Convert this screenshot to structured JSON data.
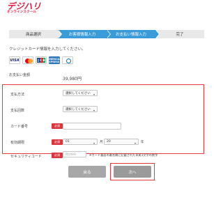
{
  "logo": {
    "main": "デジハリ",
    "sub": "オンラインスクール"
  },
  "steps": [
    {
      "label": "商品選択",
      "state": "done"
    },
    {
      "label": "お客様情報入力",
      "state": "active"
    },
    {
      "label": "お支払い情報入力",
      "state": "active"
    },
    {
      "label": "完了",
      "state": "todo"
    }
  ],
  "intro": "クレジットカード情報を入力してください。",
  "cards": {
    "visa": "VISA",
    "amex": "AMERICAN EXPRESS",
    "jcb": [
      "J",
      "C",
      "B"
    ]
  },
  "amount": {
    "label": "お支払い金額",
    "value": "39,980円"
  },
  "form": {
    "method": {
      "label": "支払方法",
      "value": "選択してください"
    },
    "installments": {
      "label": "支払回数",
      "value": "選択してください"
    },
    "card_number": {
      "label": "カード番号",
      "required": "必須",
      "value": ""
    },
    "expiry": {
      "label": "有効期限",
      "required": "必須",
      "month": "01",
      "month_unit": "月",
      "year": "20",
      "year_unit": "年"
    },
    "cvc": {
      "label": "セキュリティコード",
      "required": "必須",
      "placeholder": "例)999",
      "note": "※カード裏面の署名欄に記載された末尾3文字の数字"
    }
  },
  "buttons": {
    "back": "戻る",
    "next": "次へ"
  },
  "colors": {
    "accent": "#3a9bd9",
    "highlight": "#e8373d",
    "required": "#d9363e",
    "logo": "#e8173d"
  }
}
